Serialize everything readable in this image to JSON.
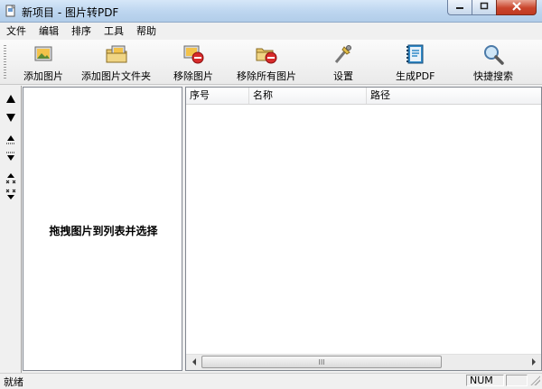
{
  "window": {
    "title": "新项目 - 图片转PDF"
  },
  "menu": [
    "文件",
    "编辑",
    "排序",
    "工具",
    "帮助"
  ],
  "toolbar": {
    "add_image": "添加图片",
    "add_folder": "添加图片文件夹",
    "remove_image": "移除图片",
    "remove_all": "移除所有图片",
    "settings": "设置",
    "generate_pdf": "生成PDF",
    "quick_search": "快捷搜索"
  },
  "preview": {
    "hint": "拖拽图片到列表并选择"
  },
  "list": {
    "columns": [
      "序号",
      "名称",
      "路径"
    ],
    "scroll_thumb": "III"
  },
  "status": {
    "text": "就绪",
    "num": "NUM"
  },
  "colors": {
    "title_bar": "#bcd5ef",
    "close_button": "#c9452c"
  }
}
